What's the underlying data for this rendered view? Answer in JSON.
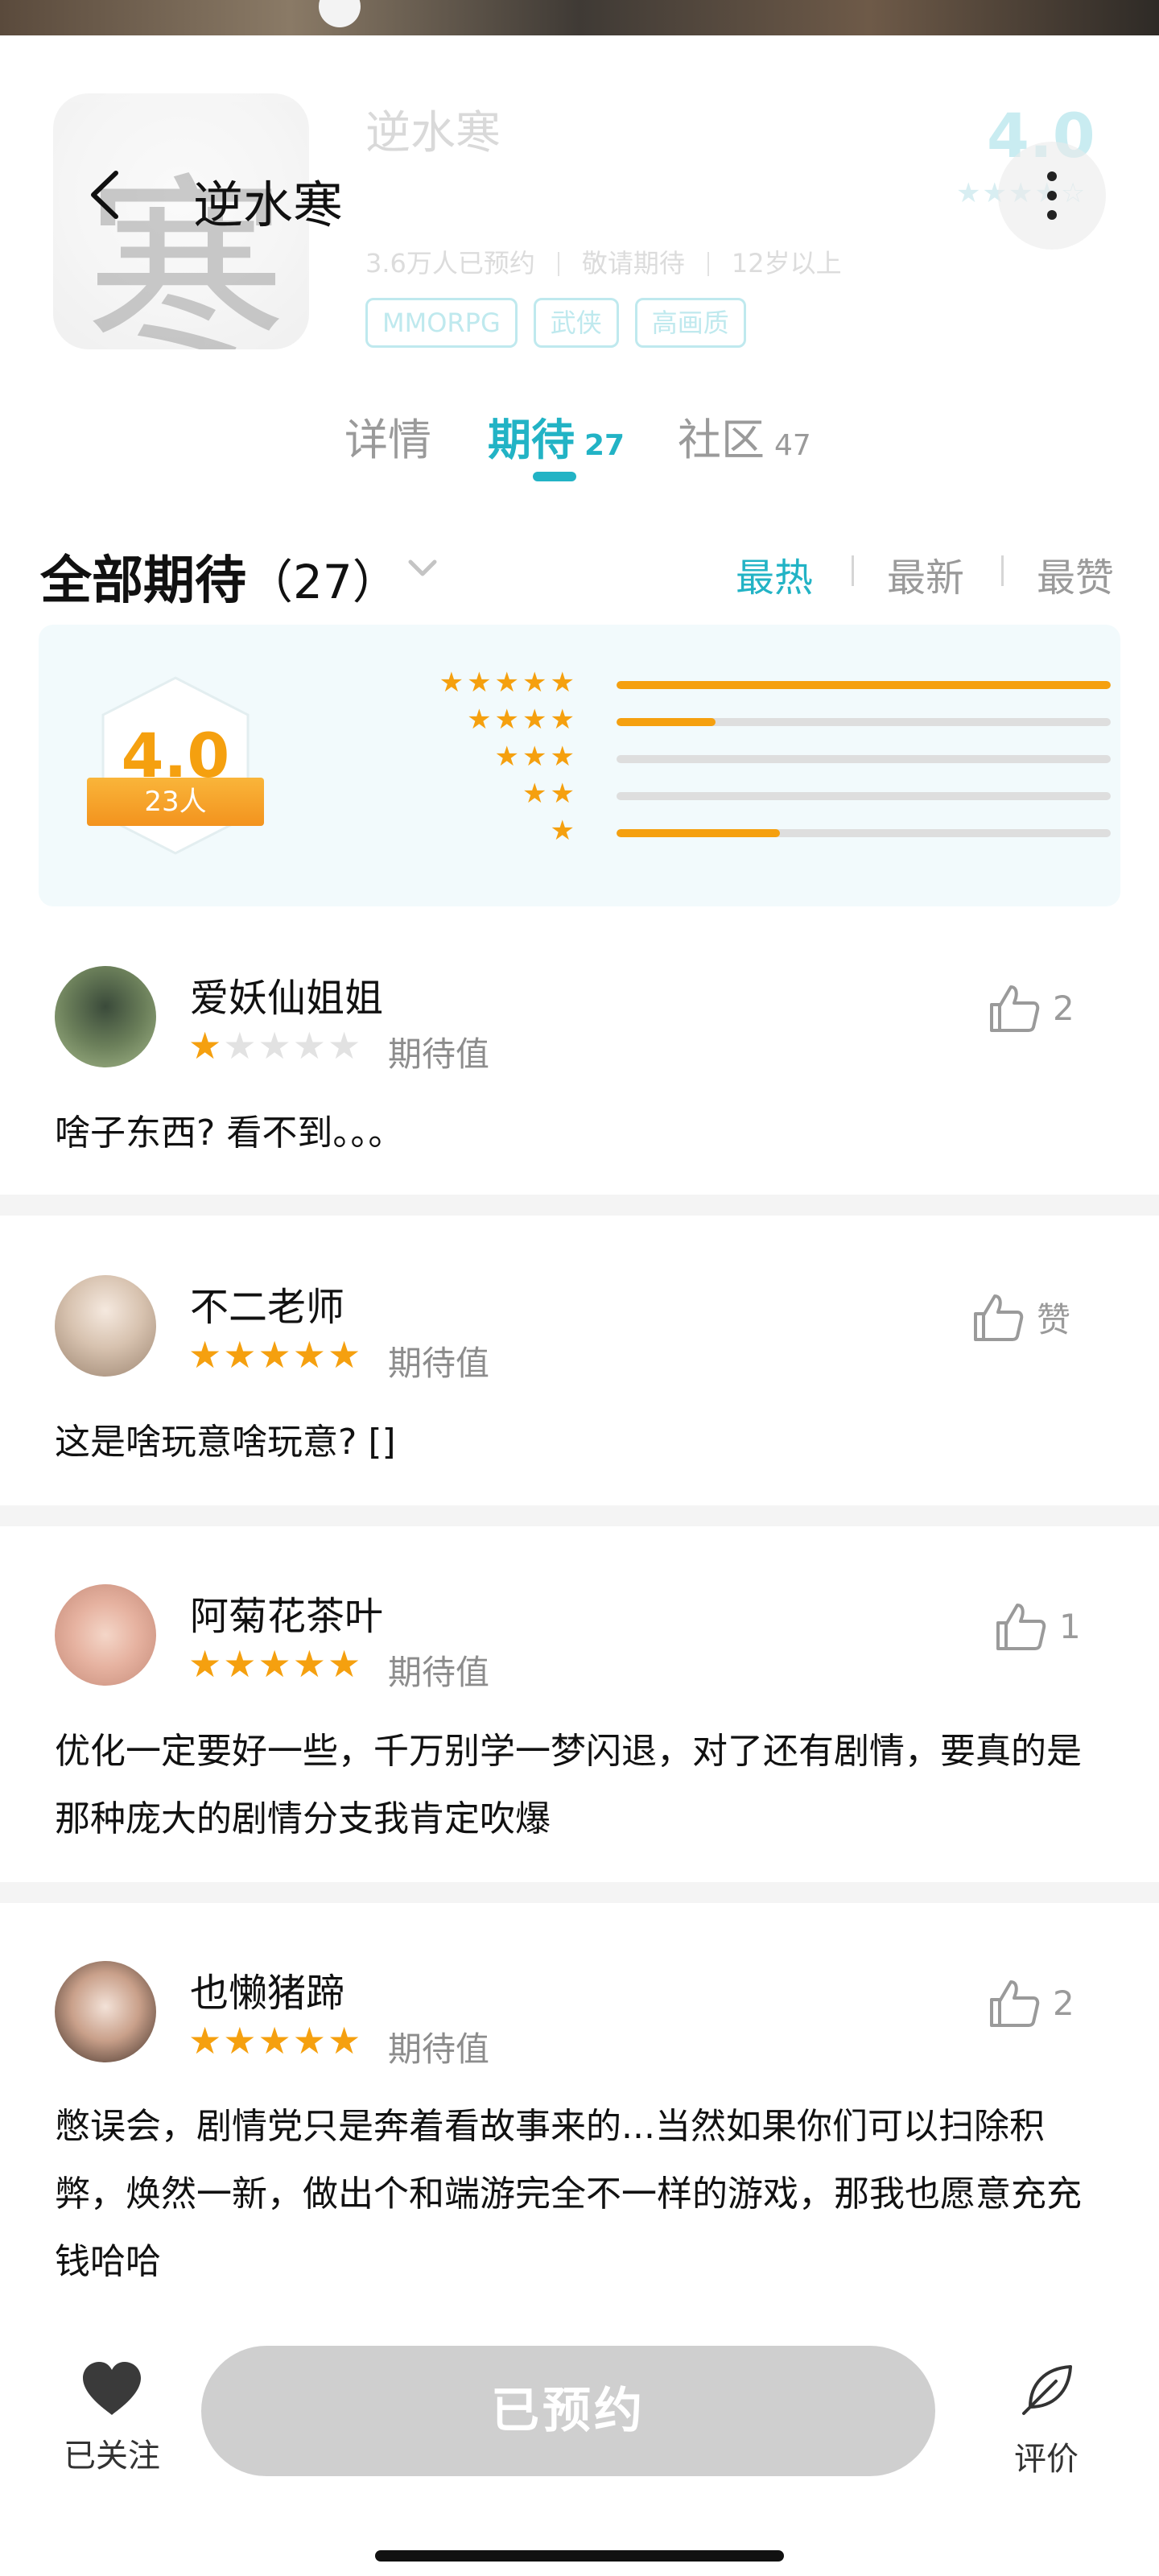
{
  "game": {
    "name": "逆水寒",
    "icon_glyph": "寒",
    "score": "4.0",
    "meta": [
      "3.6万人已预约",
      "敬请期待",
      "12岁以上"
    ],
    "tags": [
      "MMORPG",
      "武侠",
      "高画质"
    ]
  },
  "nav": {
    "title": "逆水寒"
  },
  "tabs": [
    {
      "label": "详情",
      "count": ""
    },
    {
      "label": "期待",
      "count": "27"
    },
    {
      "label": "社区",
      "count": "47"
    }
  ],
  "section": {
    "title": "全部期待",
    "count": "（27）",
    "sort": [
      "最热",
      "最新",
      "最赞"
    ]
  },
  "rating": {
    "score": "4.0",
    "people": "23人",
    "distribution": [
      {
        "stars": 5,
        "fraction": 1.0
      },
      {
        "stars": 4,
        "fraction": 0.2
      },
      {
        "stars": 3,
        "fraction": 0.0
      },
      {
        "stars": 2,
        "fraction": 0.0
      },
      {
        "stars": 1,
        "fraction": 0.33
      }
    ]
  },
  "reviews": [
    {
      "user": "爱妖仙姐姐",
      "stars": 1,
      "label": "期待值",
      "likes": "2",
      "text": "啥子东西? 看不到。。。"
    },
    {
      "user": "不二老师",
      "stars": 5,
      "label": "期待值",
      "likes": "赞",
      "text": "这是啥玩意啥玩意? []"
    },
    {
      "user": "阿菊花茶叶",
      "stars": 5,
      "label": "期待值",
      "likes": "1",
      "text": "优化一定要好一些，千万别学一梦闪退，对了还有剧情，要真的是那种庞大的剧情分支我肯定吹爆"
    },
    {
      "user": "也懒猪蹄",
      "stars": 5,
      "label": "期待值",
      "likes": "2",
      "text": "憋误会，剧情党只是奔着看故事来的...当然如果你们可以扫除积弊，焕然一新，做出个和端游完全不一样的游戏，那我也愿意充充钱哈哈"
    }
  ],
  "bottom": {
    "follow_label": "已关注",
    "reserve_label": "已预约",
    "review_label": "评价"
  },
  "colors": {
    "accent": "#22b3c5",
    "star": "#f5a00f",
    "disabled": "#cfcfcf"
  }
}
